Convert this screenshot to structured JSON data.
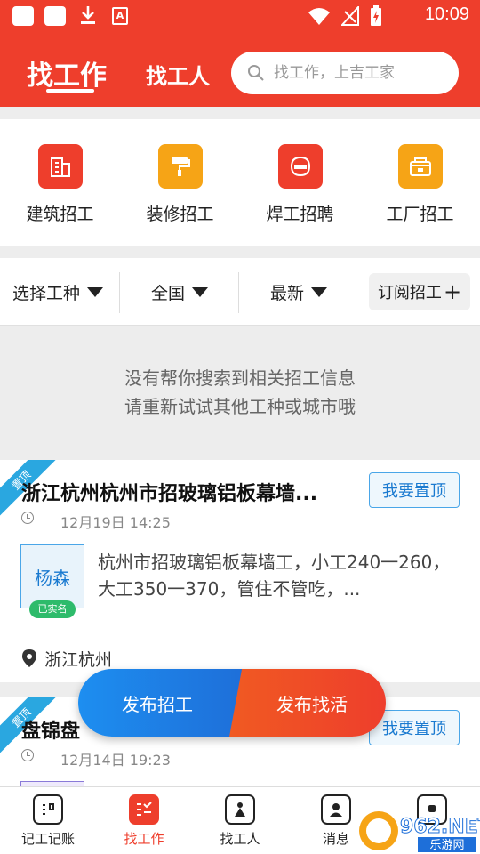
{
  "status_bar": {
    "time": "10:09",
    "app_icon_letter": "A"
  },
  "header": {
    "tab_find_job": "找工作",
    "tab_find_worker": "找工人",
    "search_placeholder": "找工作，上吉工家"
  },
  "categories": [
    {
      "label": "建筑招工",
      "icon": "building-icon",
      "color": "#ee3e2c"
    },
    {
      "label": "装修招工",
      "icon": "paint-roller-icon",
      "color": "#f6a416"
    },
    {
      "label": "焊工招聘",
      "icon": "welding-mask-icon",
      "color": "#ee3e2c"
    },
    {
      "label": "工厂招工",
      "icon": "factory-icon",
      "color": "#f6a416"
    }
  ],
  "filters": {
    "work_type": "选择工种",
    "region": "全国",
    "sort": "最新",
    "subscribe": "订阅招工",
    "subscribe_plus": "+"
  },
  "empty_state": {
    "line1": "没有帮你搜索到相关招工信息",
    "line2": "请重新试试其他工种或城市哦"
  },
  "jobs": [
    {
      "tag": "置顶",
      "title": "浙江杭州杭州市招玻璃铝板幕墙...",
      "pin_button": "我要置顶",
      "time": "12月19日 14:25",
      "avatar_name": "杨森",
      "verified": "已实名",
      "description": "杭州市招玻璃铝板幕墙工，小工240一260，大工350一370，管住不管吃，...",
      "location": "浙江杭州"
    },
    {
      "tag": "置顶",
      "title": "盘锦盘",
      "pin_button": "我要置顶",
      "time": "12月14日 19:23"
    }
  ],
  "fab": {
    "post_job": "发布招工",
    "find_work": "发布找活"
  },
  "bottom_nav": [
    {
      "label": "记工记账",
      "icon": "ledger-icon",
      "active": false
    },
    {
      "label": "找工作",
      "icon": "job-list-icon",
      "active": true
    },
    {
      "label": "找工人",
      "icon": "worker-icon",
      "active": false
    },
    {
      "label": "消息",
      "icon": "message-icon",
      "active": false
    },
    {
      "label": "",
      "icon": "profile-icon",
      "active": false
    }
  ],
  "colors": {
    "brand_red": "#ee3e2c",
    "brand_orange": "#f6a416",
    "accent_blue": "#1d8ef0",
    "verified_green": "#2ebb6b"
  },
  "watermark": {
    "text": "962.NET",
    "subtext": "乐游网"
  }
}
